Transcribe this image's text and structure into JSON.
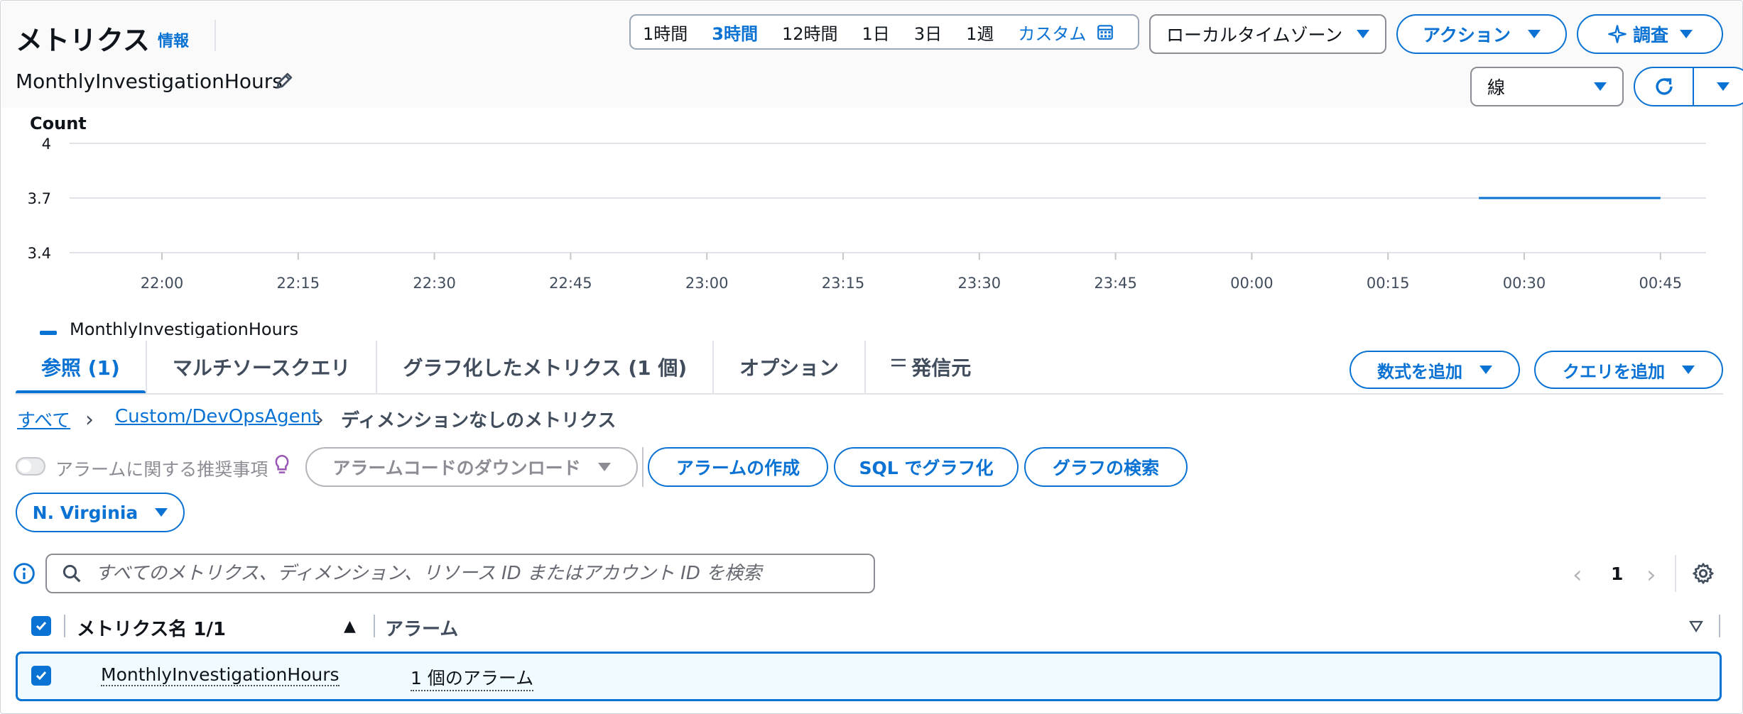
{
  "header": {
    "title": "メトリクス",
    "info": "情報",
    "metric_name": "MonthlyInvestigationHours",
    "time_ranges": [
      "1時間",
      "3時間",
      "12時間",
      "1日",
      "3日",
      "1週"
    ],
    "time_selected": "3時間",
    "custom": "カスタム",
    "timezone": "ローカルタイムゾーン",
    "actions": "アクション",
    "investigate": "調査",
    "graph_type": "線"
  },
  "chart_data": {
    "type": "line",
    "ylabel": "Count",
    "yticks": [
      "4",
      "3.7",
      "3.4"
    ],
    "ylim": [
      3.4,
      4
    ],
    "xticks": [
      "22:00",
      "22:15",
      "22:30",
      "22:45",
      "23:00",
      "23:15",
      "23:30",
      "23:45",
      "00:00",
      "00:15",
      "00:30",
      "00:45"
    ],
    "series": [
      {
        "name": "MonthlyInvestigationHours",
        "x": [
          "00:25",
          "00:45"
        ],
        "y": [
          3.7,
          3.7
        ],
        "color": "#0972d3"
      }
    ],
    "grid": true,
    "legend": "bottom-left"
  },
  "tabs": [
    "参照 (1)",
    "マルチソースクエリ",
    "グラフ化したメトリクス (1 個)",
    "オプション",
    "発信元"
  ],
  "tab_buttons": {
    "add_formula": "数式を追加",
    "add_query": "クエリを追加"
  },
  "breadcrumb": {
    "all": "すべて",
    "namespace": "Custom/DevOpsAgent",
    "current": "ディメンションなしのメトリクス"
  },
  "alarm_bar": {
    "recommend_label": "アラームに関する推奨事項",
    "download_code": "アラームコードのダウンロード",
    "create_alarm": "アラームの作成",
    "sql_graph": "SQL でグラフ化",
    "graph_search": "グラフの検索"
  },
  "region": "N. Virginia",
  "search": {
    "placeholder": "すべてのメトリクス、ディメンション、リソース ID またはアカウント ID を検索"
  },
  "pagination": {
    "page": "1"
  },
  "table": {
    "columns": [
      "メトリクス名 1/1",
      "アラーム"
    ],
    "rows": [
      {
        "name": "MonthlyInvestigationHours",
        "alarms": "1 個のアラーム",
        "checked": true
      }
    ]
  }
}
